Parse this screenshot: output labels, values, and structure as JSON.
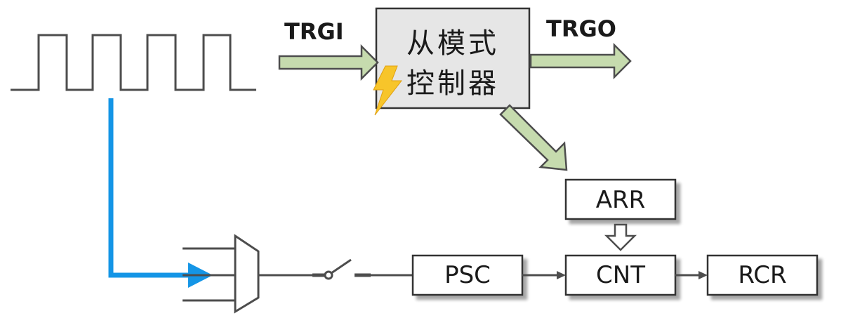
{
  "labels": {
    "trgi": "TRGI",
    "trgo": "TRGO",
    "controller_line1": "从模式",
    "controller_line2": "控制器",
    "arr": "ARR",
    "psc": "PSC",
    "cnt": "CNT",
    "rcr": "RCR"
  },
  "colors": {
    "arrow_fill": "#c6dbae",
    "arrow_stroke": "#4d4d4d",
    "controller_fill": "#e6e6e6",
    "signal_line": "#1495e6",
    "lightning": "#f7c52a",
    "wire": "#4d4d4d"
  }
}
